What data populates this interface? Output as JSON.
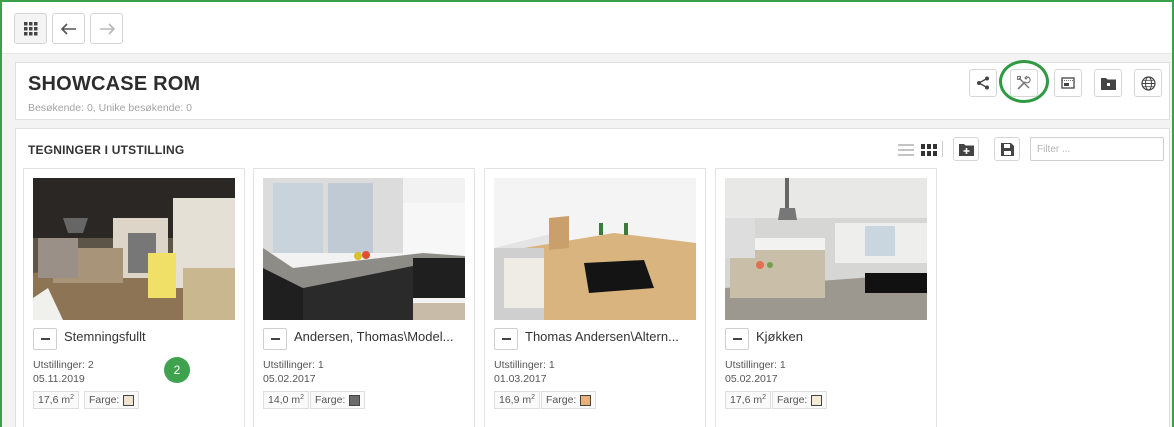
{
  "header": {
    "title": "SHOWCASE ROM",
    "subtitle": "Besøkende: 0, Unike besøkende: 0"
  },
  "toolbar": {
    "buttons": [
      "share-icon",
      "tools-icon",
      "screen-icon",
      "folder-icon",
      "globe-icon"
    ],
    "highlight_color": "#2f9a43"
  },
  "section": {
    "title": "TEGNINGER I UTSTILLING",
    "filter_placeholder": "Filter ..."
  },
  "cards": [
    {
      "title": "Stemningsfullt",
      "exhibitions": "Utstillinger: 2",
      "date": "05.11.2019",
      "area": "17,6 m",
      "area_unit_sup": "2",
      "color_label": "Farge:",
      "swatch": "#efe3cf"
    },
    {
      "title": "Andersen, Thomas\\Model...",
      "exhibitions": "Utstillinger: 1",
      "date": "05.02.2017",
      "area": "14,0 m",
      "area_unit_sup": "2",
      "color_label": "Farge:",
      "swatch": "#6b6b6b"
    },
    {
      "title": "Thomas Andersen\\Altern...",
      "exhibitions": "Utstillinger: 1",
      "date": "01.03.2017",
      "area": "16,9 m",
      "area_unit_sup": "2",
      "color_label": "Farge:",
      "swatch": "#e8b07a"
    },
    {
      "title": "Kjøkken",
      "exhibitions": "Utstillinger: 1",
      "date": "05.02.2017",
      "area": "17,6 m",
      "area_unit_sup": "2",
      "color_label": "Farge:",
      "swatch": "#f3ead8"
    }
  ],
  "step_badge": "2"
}
